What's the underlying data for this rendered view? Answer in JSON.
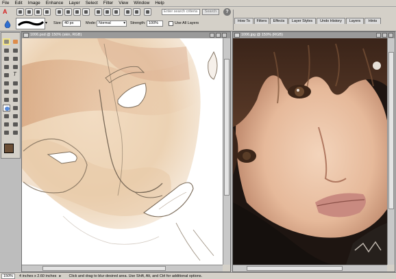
{
  "menu": [
    "File",
    "Edit",
    "Image",
    "Enhance",
    "Layer",
    "Select",
    "Filter",
    "View",
    "Window",
    "Help"
  ],
  "options": {
    "size_label": "Size:",
    "size_value": "40 px",
    "mode_label": "Mode:",
    "mode_value": "Normal",
    "strength_label": "Strength:",
    "strength_value": "100%",
    "use_all_layers": "Use All Layers",
    "use_all_layers_checked": false
  },
  "search": {
    "placeholder": "Enter search criteria",
    "button": "Search"
  },
  "panel_tabs": [
    "How To",
    "Filters",
    "Effects",
    "Layer Styles",
    "Undo History",
    "Layers",
    "Hints"
  ],
  "documents": [
    {
      "title": "1006.psd @ 150% (skin, RGB)"
    },
    {
      "title": "1006.jpg @ 150% (RGB)"
    }
  ],
  "status": {
    "zoom": "150%",
    "doc_size": "4 inches x 2.60 inches",
    "hint": "Click and drag to blur desired area. Use Shift, Alt, and Ctrl for additional options."
  },
  "colors": {
    "foreground": "#6b4e35",
    "background": "#ffffff",
    "accent": "#d42020"
  }
}
